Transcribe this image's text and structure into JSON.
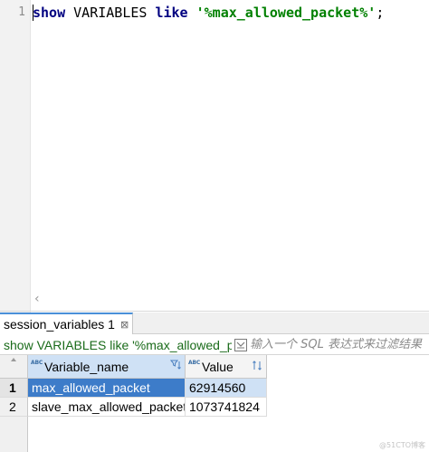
{
  "editor": {
    "line_number": "1",
    "code": {
      "kw1": "show",
      "mid": " VARIABLES ",
      "kw2": "like",
      "space": " ",
      "string": "'%max_allowed_packet%'",
      "end": ";"
    },
    "scroll_left_glyph": "‹"
  },
  "results": {
    "tab_label": "session_variables 1",
    "tab_close_glyph": "⊠",
    "filter": {
      "query_text": "show VARIABLES like '%max_allowed_pa",
      "placeholder": "输入一个 SQL 表达式来过滤结果"
    },
    "grid": {
      "columns": [
        {
          "badge": "ABC",
          "label": "Variable_name"
        },
        {
          "badge": "ABC",
          "label": "Value"
        }
      ],
      "rows": [
        {
          "index": "1",
          "cells": [
            "max_allowed_packet",
            "62914560"
          ]
        },
        {
          "index": "2",
          "cells": [
            "slave_max_allowed_packet",
            "1073741824"
          ]
        }
      ]
    },
    "watermark": "@51CTO博客"
  },
  "colors": {
    "keyword": "#000080",
    "string": "#008000",
    "selection": "#3d7cc9",
    "selection_light": "#cfe1f5",
    "filter_text": "#1a6b1a"
  }
}
